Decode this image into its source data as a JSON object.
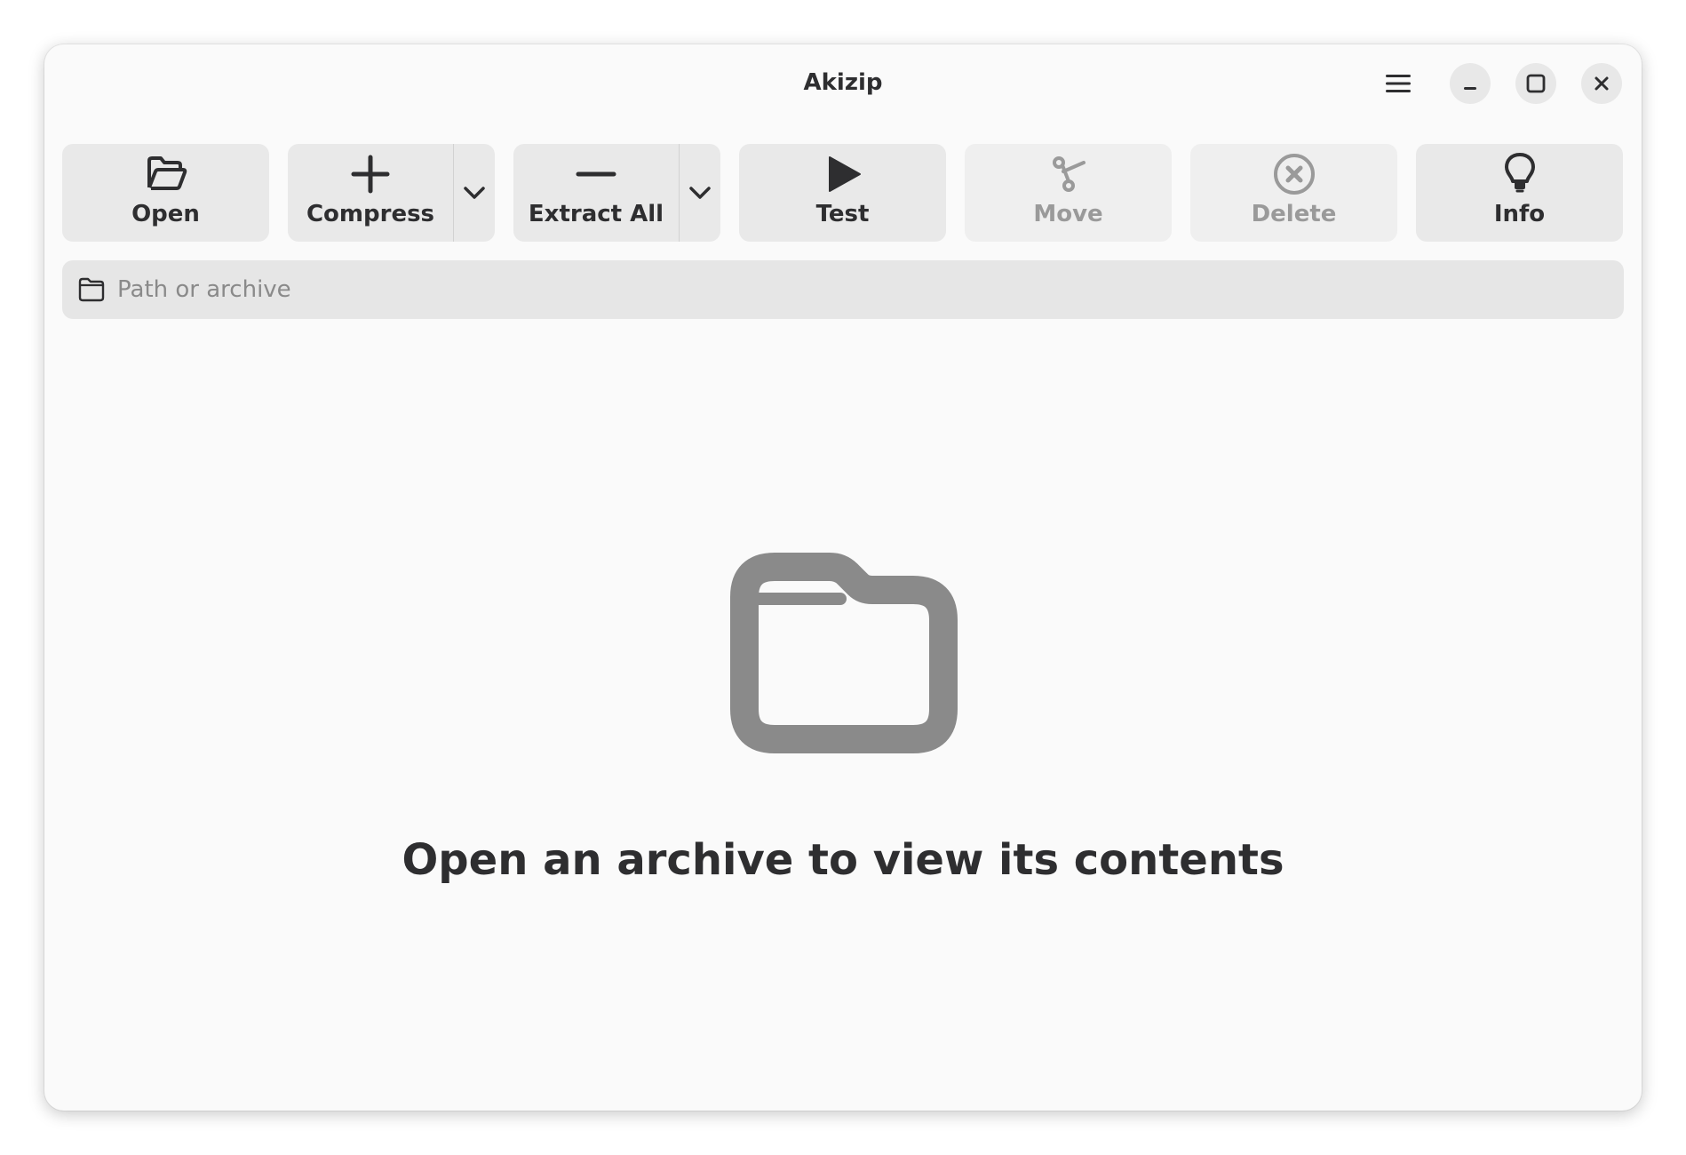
{
  "window": {
    "title": "Akizip"
  },
  "header": {
    "menu_icon": "hamburger-menu-icon",
    "minimize_icon": "minimize-icon",
    "maximize_icon": "maximize-icon",
    "close_icon": "close-icon"
  },
  "toolbar": {
    "open": {
      "label": "Open",
      "icon": "folder-open-icon",
      "enabled": true
    },
    "compress": {
      "label": "Compress",
      "icon": "plus-icon",
      "enabled": true,
      "has_dropdown": true
    },
    "extract_all": {
      "label": "Extract All",
      "icon": "minus-icon",
      "enabled": true,
      "has_dropdown": true
    },
    "test": {
      "label": "Test",
      "icon": "play-icon",
      "enabled": true
    },
    "move": {
      "label": "Move",
      "icon": "cut-icon",
      "enabled": false
    },
    "delete": {
      "label": "Delete",
      "icon": "delete-circle-icon",
      "enabled": false
    },
    "info": {
      "label": "Info",
      "icon": "lightbulb-icon",
      "enabled": true
    }
  },
  "pathbar": {
    "icon": "folder-icon",
    "placeholder": "Path or archive",
    "value": ""
  },
  "empty_state": {
    "icon": "folder-icon",
    "message": "Open an archive to view its contents"
  },
  "colors": {
    "window_bg": "#fafafa",
    "button_bg": "#e9e9e9",
    "text": "#2e2e30",
    "disabled_text": "#9a9a9a",
    "empty_icon": "#8a8a8a"
  }
}
